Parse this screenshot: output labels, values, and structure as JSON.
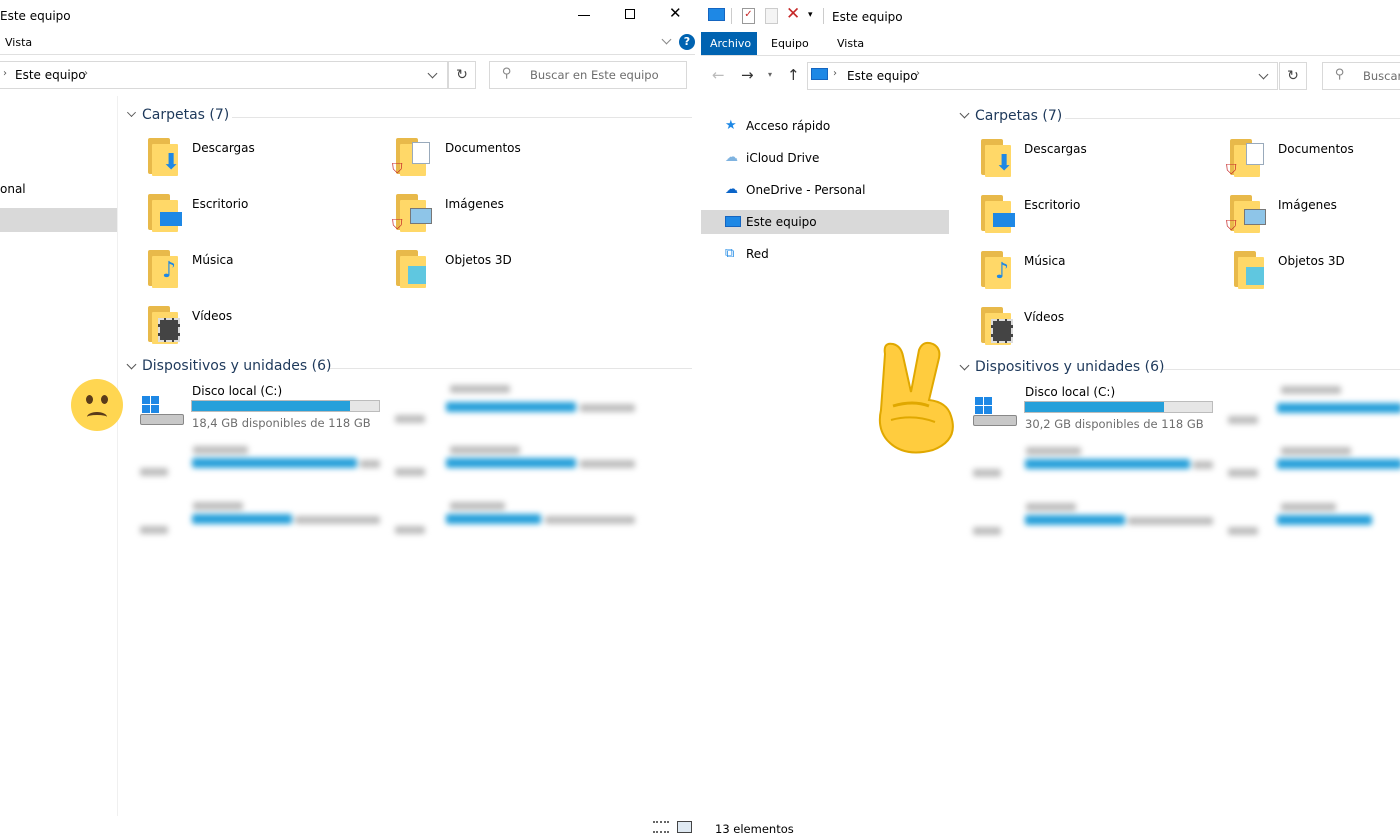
{
  "left": {
    "title": "Este equipo",
    "menu_vista": "Vista",
    "address": "Este equipo",
    "search_placeholder": "Buscar en Este equipo",
    "nav_fragment": "onal",
    "folders_header": "Carpetas (7)",
    "devices_header": "Dispositivos y unidades (6)",
    "folders": [
      {
        "label": "Descargas"
      },
      {
        "label": "Documentos"
      },
      {
        "label": "Escritorio"
      },
      {
        "label": "Imágenes"
      },
      {
        "label": "Música"
      },
      {
        "label": "Objetos 3D"
      },
      {
        "label": "Vídeos"
      }
    ],
    "disk": {
      "name": "Disco local (C:)",
      "free_text": "18,4 GB disponibles de 118 GB",
      "used_fraction": 0.844
    },
    "emoji": "sad-face"
  },
  "right": {
    "title": "Este equipo",
    "tabs": [
      "Archivo",
      "Equipo",
      "Vista"
    ],
    "address": "Este equipo",
    "search_placeholder": "Buscar",
    "nav": [
      {
        "label": "Acceso rápido",
        "icon": "star-icon"
      },
      {
        "label": "iCloud Drive",
        "icon": "cloud-icon"
      },
      {
        "label": "OneDrive - Personal",
        "icon": "onedrive-icon"
      },
      {
        "label": "Este equipo",
        "icon": "computer-icon"
      },
      {
        "label": "Red",
        "icon": "network-icon"
      }
    ],
    "folders_header": "Carpetas (7)",
    "devices_header": "Dispositivos y unidades (6)",
    "folders": [
      {
        "label": "Descargas"
      },
      {
        "label": "Documentos"
      },
      {
        "label": "Escritorio"
      },
      {
        "label": "Imágenes"
      },
      {
        "label": "Música"
      },
      {
        "label": "Objetos 3D"
      },
      {
        "label": "Vídeos"
      }
    ],
    "disk": {
      "name": "Disco local (C:)",
      "free_text": "30,2 GB disponibles de 118 GB",
      "used_fraction": 0.744
    },
    "status": "13 elementos",
    "emoji": "victory-hand"
  },
  "colors": {
    "accent": "#0063b1",
    "bar_fill": "#26a0da",
    "folder": "#ffd868",
    "header_text": "#1e395b"
  }
}
